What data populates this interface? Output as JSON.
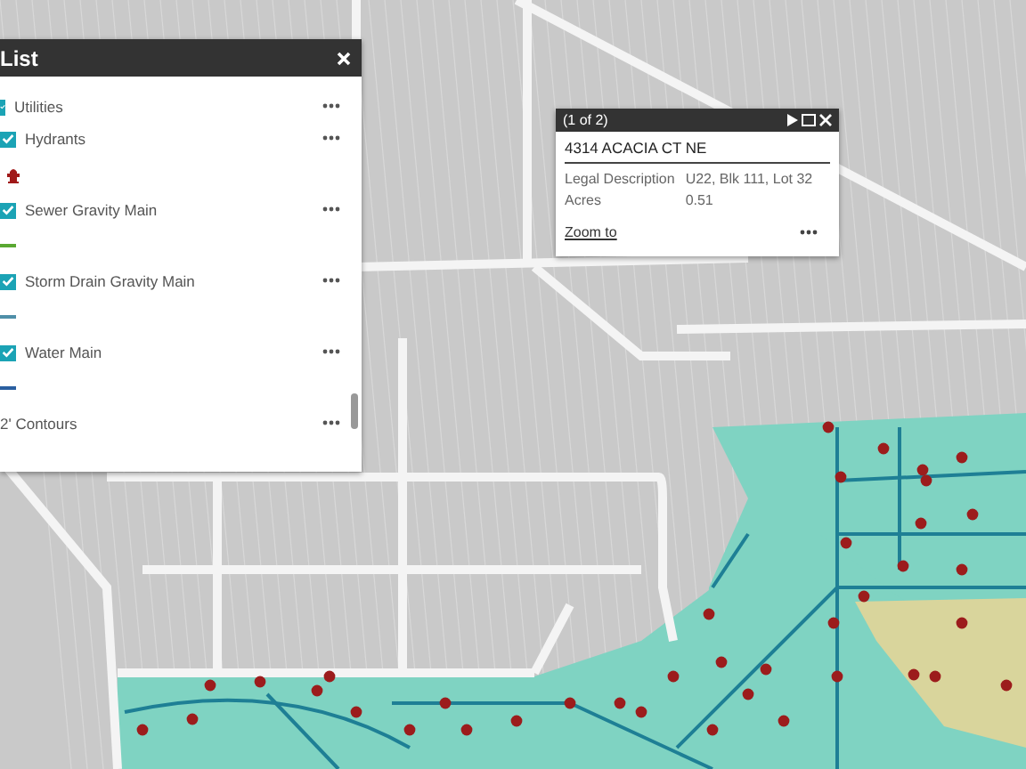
{
  "layer_panel": {
    "title": "List",
    "layers": [
      {
        "kind": "group",
        "label": "Utilities",
        "checked": true
      },
      {
        "kind": "layer",
        "label": "Hydrants",
        "checked": true,
        "legend": {
          "kind": "hydrant"
        }
      },
      {
        "kind": "layer",
        "label": "Sewer Gravity Main",
        "checked": true,
        "legend": {
          "kind": "line"
        },
        "color": "#5aa832"
      },
      {
        "kind": "layer",
        "label": "Storm Drain Gravity Main",
        "checked": true,
        "legend": {
          "kind": "line"
        },
        "color": "#4f8fa8"
      },
      {
        "kind": "layer",
        "label": "Water Main",
        "checked": true,
        "legend": {
          "kind": "line"
        },
        "color": "#2a5fa0"
      },
      {
        "kind": "group",
        "label": "2' Contours"
      }
    ]
  },
  "popup": {
    "counter": "(1 of 2)",
    "title": "4314 ACACIA CT NE",
    "fields": [
      {
        "label": "Legal Description",
        "value": "U22, Blk 111, Lot 32"
      },
      {
        "label": "Acres",
        "value": "0.51"
      }
    ],
    "link": "Zoom to"
  }
}
